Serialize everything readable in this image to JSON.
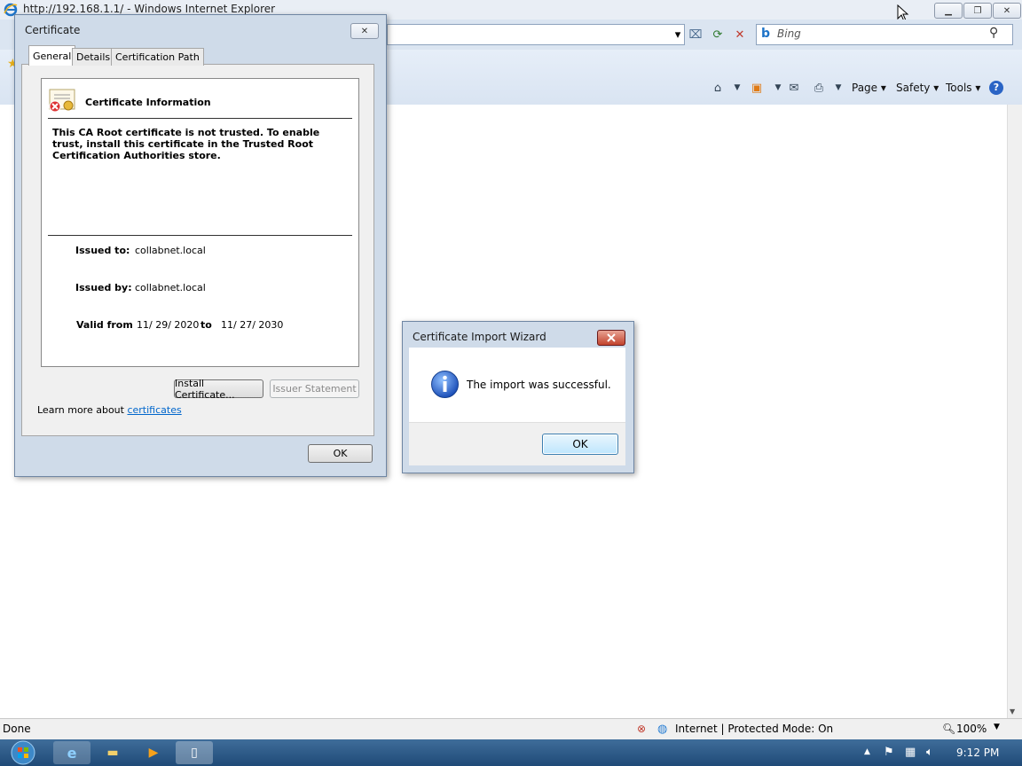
{
  "browser": {
    "title": "http://192.168.1.1/ - Windows Internet Explorer",
    "search_placeholder": "Bing",
    "commands": {
      "page": "Page",
      "safety": "Safety",
      "tools": "Tools"
    }
  },
  "status_bar": {
    "status": "Done",
    "zone": "Internet | Protected Mode: On",
    "zoom": "100%"
  },
  "taskbar": {
    "clock": "9:12 PM"
  },
  "certificate_dialog": {
    "title": "Certificate",
    "tabs": [
      "General",
      "Details",
      "Certification Path"
    ],
    "heading": "Certificate Information",
    "message": "This CA Root certificate is not trusted. To enable trust, install this certificate in the Trusted Root Certification Authorities store.",
    "issued_to_label": "Issued to:",
    "issued_to": "collabnet.local",
    "issued_by_label": "Issued by:",
    "issued_by": "collabnet.local",
    "valid_from_label": "Valid from",
    "valid_from": "11/ 29/ 2020",
    "valid_to_label": "to",
    "valid_to": "11/ 27/ 2030",
    "install_button": "Install Certificate...",
    "issuer_statement_button": "Issuer Statement",
    "learn_more_text": "Learn more about ",
    "learn_more_link": "certificates",
    "ok_button": "OK"
  },
  "import_wizard": {
    "title": "Certificate Import Wizard",
    "message": "The import was successful.",
    "ok_button": "OK"
  },
  "colors": {
    "link": "#0066cc",
    "taskbar": "#2b5a88",
    "close_red": "#c2432d"
  }
}
